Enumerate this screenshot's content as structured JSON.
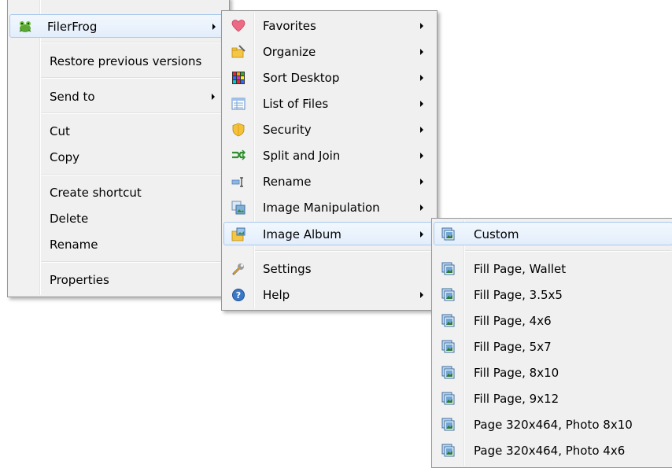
{
  "main_menu": {
    "items": [
      {
        "label": "FilerFrog",
        "icon": "frog-icon",
        "submenu": true
      },
      {
        "label": "Restore previous versions"
      },
      {
        "label": "Send to",
        "submenu": true
      },
      {
        "label": "Cut"
      },
      {
        "label": "Copy"
      },
      {
        "label": "Create shortcut"
      },
      {
        "label": "Delete"
      },
      {
        "label": "Rename"
      },
      {
        "label": "Properties"
      }
    ]
  },
  "filerfrog_menu": {
    "items": [
      {
        "label": "Favorites",
        "icon": "heart-icon",
        "submenu": true
      },
      {
        "label": "Organize",
        "icon": "organize-folder-icon",
        "submenu": true
      },
      {
        "label": "Sort Desktop",
        "icon": "sort-desktop-icon",
        "submenu": true
      },
      {
        "label": "List of Files",
        "icon": "list-icon",
        "submenu": true
      },
      {
        "label": "Security",
        "icon": "shield-icon",
        "submenu": true
      },
      {
        "label": "Split and Join",
        "icon": "split-join-icon",
        "submenu": true
      },
      {
        "label": "Rename",
        "icon": "rename-icon",
        "submenu": true
      },
      {
        "label": "Image Manipulation",
        "icon": "image-manipulation-icon",
        "submenu": true
      },
      {
        "label": "Image Album",
        "icon": "image-album-icon",
        "submenu": true
      },
      {
        "label": "Settings",
        "icon": "wrench-icon"
      },
      {
        "label": "Help",
        "icon": "help-icon",
        "submenu": true
      }
    ]
  },
  "image_album_menu": {
    "items": [
      {
        "label": "Custom"
      },
      {
        "label": "Fill Page, Wallet"
      },
      {
        "label": "Fill Page, 3.5x5"
      },
      {
        "label": "Fill Page, 4x6"
      },
      {
        "label": "Fill Page, 5x7"
      },
      {
        "label": "Fill Page, 8x10"
      },
      {
        "label": "Fill Page, 9x12"
      },
      {
        "label": "Page 320x464, Photo 8x10"
      },
      {
        "label": "Page 320x464, Photo 4x6"
      }
    ],
    "item_icon": "photo-stack-icon"
  },
  "colors": {
    "menu_bg": "#f0f0f0",
    "highlight_border": "#a8c9ee",
    "highlight_bg": "#e3eefb"
  }
}
